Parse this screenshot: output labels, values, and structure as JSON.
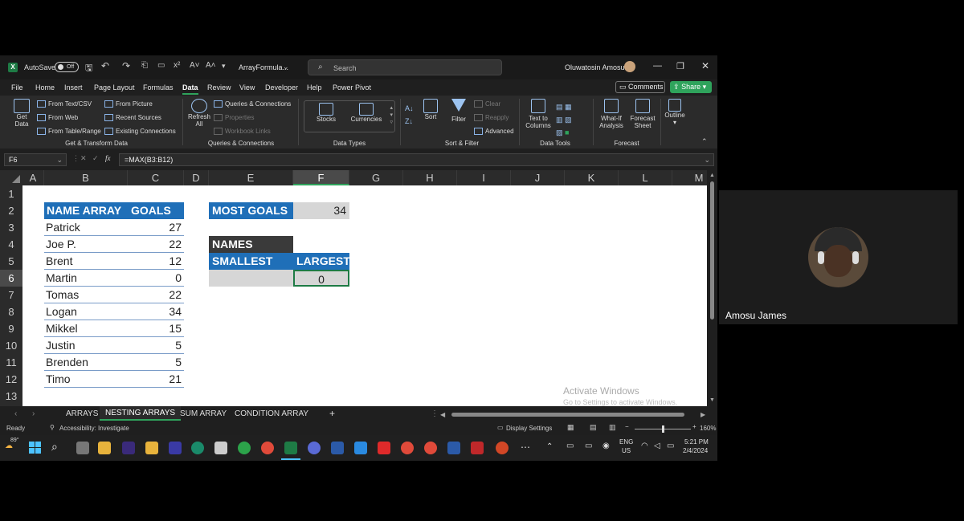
{
  "titlebar": {
    "autosave": "AutoSave",
    "autosave_state": "Off",
    "filename": "ArrayFormula...",
    "search_placeholder": "Search",
    "user": "Oluwatosin Amosu"
  },
  "menu": [
    "File",
    "Home",
    "Insert",
    "Page Layout",
    "Formulas",
    "Data",
    "Review",
    "View",
    "Developer",
    "Help",
    "Power Pivot"
  ],
  "menu_active": "Data",
  "actions": {
    "comments": "Comments",
    "share": "Share"
  },
  "ribbon": {
    "get_data": "Get Data",
    "from_text": "From Text/CSV",
    "from_web": "From Web",
    "from_table": "From Table/Range",
    "from_picture": "From Picture",
    "recent_sources": "Recent Sources",
    "existing_connections": "Existing Connections",
    "group_get": "Get & Transform Data",
    "refresh_all": "Refresh All",
    "queries": "Queries & Connections",
    "properties": "Properties",
    "workbook_links": "Workbook Links",
    "group_queries": "Queries & Connections",
    "stocks": "Stocks",
    "currencies": "Currencies",
    "group_types": "Data Types",
    "sort": "Sort",
    "filter": "Filter",
    "clear": "Clear",
    "reapply": "Reapply",
    "advanced": "Advanced",
    "group_sort": "Sort & Filter",
    "text_to_columns": "Text to Columns",
    "group_tools": "Data Tools",
    "what_if": "What-If Analysis",
    "forecast_sheet": "Forecast Sheet",
    "group_forecast": "Forecast",
    "outline": "Outline"
  },
  "formula_bar": {
    "cell_ref": "F6",
    "fx": "fx",
    "formula": "=MAX(B3:B12)"
  },
  "columns": [
    "A",
    "B",
    "C",
    "D",
    "E",
    "F",
    "G",
    "H",
    "I",
    "J",
    "K",
    "L",
    "M"
  ],
  "rows": [
    "1",
    "2",
    "3",
    "4",
    "5",
    "6",
    "7",
    "8",
    "9",
    "10",
    "11",
    "12",
    "13"
  ],
  "table": {
    "header_name": "NAME ARRAY",
    "header_goals": "GOALS",
    "rows": [
      {
        "name": "Patrick",
        "goals": "27"
      },
      {
        "name": "Joe P.",
        "goals": "22"
      },
      {
        "name": "Brent",
        "goals": "12"
      },
      {
        "name": "Martin",
        "goals": "0"
      },
      {
        "name": "Tomas",
        "goals": "22"
      },
      {
        "name": "Logan",
        "goals": "34"
      },
      {
        "name": "Mikkel",
        "goals": "15"
      },
      {
        "name": "Justin",
        "goals": "5"
      },
      {
        "name": "Brenden",
        "goals": "5"
      },
      {
        "name": "Timo",
        "goals": "21"
      }
    ]
  },
  "most_goals": {
    "label": "MOST GOALS",
    "value": "34"
  },
  "names_box": {
    "names": "NAMES",
    "smallest": "SMALLEST",
    "largest": "LARGEST",
    "largest_value": "0"
  },
  "sheet_tabs": [
    "ARRAYS",
    "NESTING ARRAYS",
    "SUM ARRAY",
    "CONDITION ARRAY"
  ],
  "sheet_active": "NESTING ARRAYS",
  "watermark": {
    "line1": "Activate Windows",
    "line2": "Go to Settings to activate Windows."
  },
  "status": {
    "ready": "Ready",
    "accessibility": "Accessibility: Investigate",
    "display": "Display Settings",
    "zoom": "160%"
  },
  "taskbar": {
    "temp": "89°",
    "lang": "ENG",
    "region": "US",
    "time": "5:21 PM",
    "date": "2/4/2024"
  },
  "participant": {
    "name": "Amosu James"
  },
  "colors": {
    "header_blue": "#1f6fb8",
    "excel_green": "#1e7b45",
    "dark_header": "#3a3a3a"
  }
}
